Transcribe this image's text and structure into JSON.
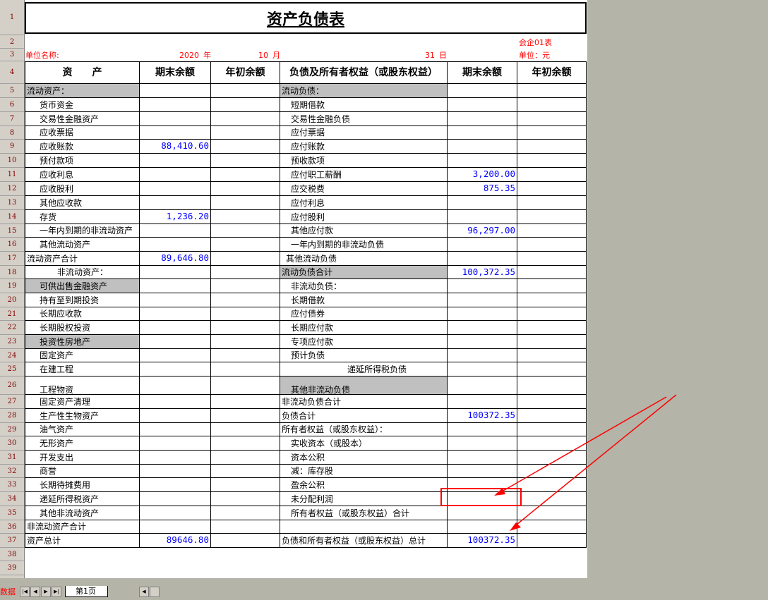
{
  "title": "资产负债表",
  "info": {
    "form_no": "会企01表",
    "unit_label": "单位名称:",
    "year": "2020",
    "year_suffix": "年",
    "month": "10",
    "month_suffix": "月",
    "day": "31",
    "day_suffix": "日",
    "currency_unit": "单位：元"
  },
  "headers": [
    "资　　产",
    "期末余额",
    "年初余额",
    "负债及所有者权益（或股东权益）",
    "期末余额",
    "年初余额"
  ],
  "row_numbers": [
    "1",
    "2",
    "3",
    "4",
    "5",
    "6",
    "7",
    "8",
    "9",
    "10",
    "11",
    "12",
    "13",
    "14",
    "15",
    "16",
    "17",
    "18",
    "19",
    "20",
    "21",
    "22",
    "23",
    "24",
    "25",
    "26",
    "27",
    "28",
    "29",
    "30",
    "31",
    "32",
    "33",
    "34",
    "35",
    "36",
    "37",
    "38",
    "39"
  ],
  "rows": [
    {
      "a": "流动资产：",
      "a_end": "",
      "b": "流动负债：",
      "b_end": ""
    },
    {
      "a": "货币资金",
      "a_end": "",
      "b": "短期借款",
      "b_end": ""
    },
    {
      "a": "交易性金融资产",
      "a_end": "",
      "b": "交易性金融负债",
      "b_end": ""
    },
    {
      "a": "应收票据",
      "a_end": "",
      "b": "应付票据",
      "b_end": ""
    },
    {
      "a": "应收账款",
      "a_end": "88,410.60",
      "b": "应付账款",
      "b_end": ""
    },
    {
      "a": "预付款项",
      "a_end": "",
      "b": "预收款项",
      "b_end": ""
    },
    {
      "a": "应收利息",
      "a_end": "",
      "b": "应付职工薪酬",
      "b_end": "3,200.00"
    },
    {
      "a": "应收股利",
      "a_end": "",
      "b": "应交税费",
      "b_end": "875.35"
    },
    {
      "a": "其他应收款",
      "a_end": "",
      "b": "应付利息",
      "b_end": ""
    },
    {
      "a": "存货",
      "a_end": "1,236.20",
      "b": "应付股利",
      "b_end": ""
    },
    {
      "a": "一年内到期的非流动资产",
      "a_end": "",
      "b": "其他应付款",
      "b_end": "96,297.00"
    },
    {
      "a": "其他流动资产",
      "a_end": "",
      "b": "一年内到期的非流动负债",
      "b_end": ""
    },
    {
      "a": "流动资产合计",
      "a_end": "89,646.80",
      "b": "其他流动负债",
      "b_end": ""
    },
    {
      "a": "非流动资产：",
      "a_end": "",
      "b": "流动负债合计",
      "b_end": "100,372.35"
    },
    {
      "a": "可供出售金融资产",
      "a_end": "",
      "b": "非流动负债：",
      "b_end": ""
    },
    {
      "a": "持有至到期投资",
      "a_end": "",
      "b": "长期借款",
      "b_end": ""
    },
    {
      "a": "长期应收款",
      "a_end": "",
      "b": "应付债券",
      "b_end": ""
    },
    {
      "a": "长期股权投资",
      "a_end": "",
      "b": "长期应付款",
      "b_end": ""
    },
    {
      "a": "投资性房地产",
      "a_end": "",
      "b": "专项应付款",
      "b_end": ""
    },
    {
      "a": "固定资产",
      "a_end": "",
      "b": "预计负债",
      "b_end": ""
    },
    {
      "a": "在建工程",
      "a_end": "",
      "b": "递延所得税负债",
      "b_end": ""
    },
    {
      "a": "工程物资",
      "a_end": "",
      "b": "其他非流动负债",
      "b_end": ""
    },
    {
      "a": "固定资产清理",
      "a_end": "",
      "b": "非流动负债合计",
      "b_end": ""
    },
    {
      "a": "生产性生物资产",
      "a_end": "",
      "b": "负债合计",
      "b_end": "100372.35"
    },
    {
      "a": "油气资产",
      "a_end": "",
      "b": "所有者权益（或股东权益）：",
      "b_end": ""
    },
    {
      "a": "无形资产",
      "a_end": "",
      "b": "实收资本（或股本）",
      "b_end": ""
    },
    {
      "a": "开发支出",
      "a_end": "",
      "b": "资本公积",
      "b_end": ""
    },
    {
      "a": "商誉",
      "a_end": "",
      "b": "减：库存股",
      "b_end": ""
    },
    {
      "a": "长期待摊费用",
      "a_end": "",
      "b": "盈余公积",
      "b_end": ""
    },
    {
      "a": "递延所得税资产",
      "a_end": "",
      "b": "未分配利润",
      "b_end": ""
    },
    {
      "a": "其他非流动资产",
      "a_end": "",
      "b": "所有者权益（或股东权益）合计",
      "b_end": ""
    },
    {
      "a": "非流动资产合计",
      "a_end": "",
      "b": "",
      "b_end": ""
    },
    {
      "a": "资产总计",
      "a_end": "89646.80",
      "b": "负债和所有者权益（或股东权益）总计",
      "b_end": "100372.35"
    }
  ],
  "sheet_tab": "第1页",
  "left_tab_fragment": "数据",
  "colors": {
    "accent_red": "#ff0000",
    "value_blue": "#0000ff",
    "header_gray": "#c0c0c0"
  }
}
